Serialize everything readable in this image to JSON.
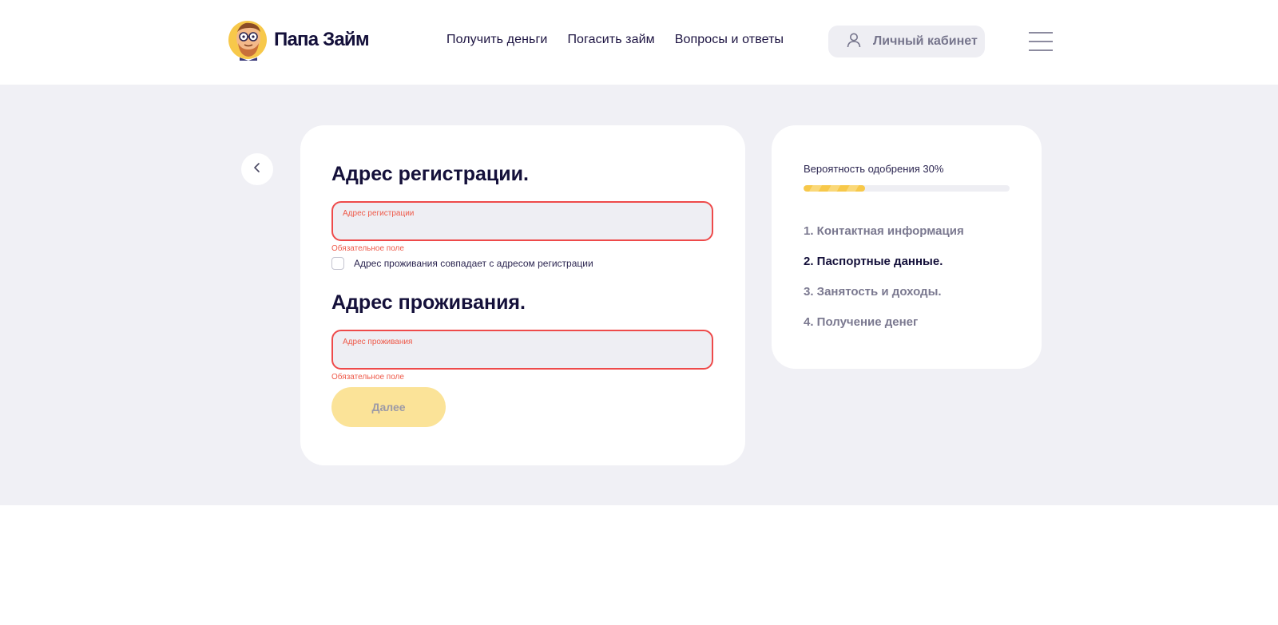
{
  "header": {
    "logo_text": "Папа Займ",
    "nav": [
      {
        "label": "Получить деньги"
      },
      {
        "label": "Погасить займ"
      },
      {
        "label": "Вопросы и ответы"
      }
    ],
    "cabinet_label": "Личный кабинет",
    "icons": {
      "cabinet": "user-icon",
      "menu": "burger-menu-icon"
    }
  },
  "form": {
    "back_icon": "chevron-left-icon",
    "registration": {
      "title": "Адрес регистрации.",
      "field_label": "Адрес регистрации",
      "value": "",
      "error": "Обязательное поле"
    },
    "same_address": {
      "label": "Адрес проживания совпадает с адресом регистрации",
      "checked": false
    },
    "residence": {
      "title": "Адрес проживания.",
      "field_label": "Адрес проживания",
      "value": "",
      "error": "Обязательное поле"
    },
    "next_label": "Далее"
  },
  "sidebar": {
    "probability_text": "Вероятность одобрения 30%",
    "probability": 0.3,
    "steps": [
      {
        "label": "1. Контактная информация",
        "active": false
      },
      {
        "label": "2. Паспортные данные.",
        "active": true
      },
      {
        "label": "3. Занятость и доходы.",
        "active": false
      },
      {
        "label": "4. Получение денег",
        "active": false
      }
    ]
  },
  "colors": {
    "accent_yellow": "#f7c84a",
    "button_disabled": "#fbe398",
    "error": "#ee4a4a",
    "text_dark": "#14103a",
    "background": "#f0f0f5"
  }
}
